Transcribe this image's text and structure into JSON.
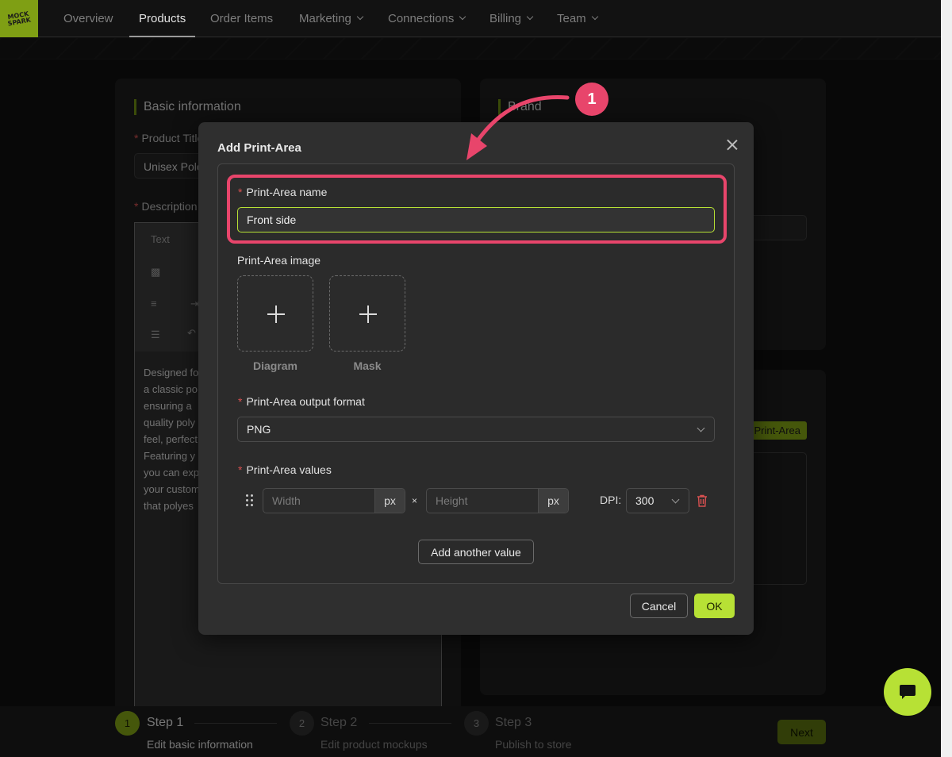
{
  "nav": {
    "logo_text": "MOCK\nSPARK",
    "items": [
      {
        "label": "Overview"
      },
      {
        "label": "Products"
      },
      {
        "label": "Order Items"
      },
      {
        "label": "Marketing"
      },
      {
        "label": "Connections"
      },
      {
        "label": "Billing"
      },
      {
        "label": "Team"
      }
    ]
  },
  "background": {
    "left_panel_title": "Basic information",
    "product_title_label": "Product Title",
    "product_title_value": "Unisex Polo",
    "description_label": "Description",
    "toolbar_text": "Text",
    "description_lines": [
      "Designed fo",
      "a classic po",
      "ensuring a",
      "quality poly",
      "feel, perfect",
      "Featuring y",
      "you can exp",
      "your custom",
      "that polyes"
    ],
    "right_panel_title": "Brand",
    "print_area_tag": "Print-Area"
  },
  "modal": {
    "title": "Add Print-Area",
    "name_label": "Print-Area name",
    "name_value": "Front side",
    "image_label": "Print-Area image",
    "upload_diagram": "Diagram",
    "upload_mask": "Mask",
    "format_label": "Print-Area output format",
    "format_value": "PNG",
    "values_label": "Print-Area values",
    "width_placeholder": "Width",
    "height_placeholder": "Height",
    "unit": "px",
    "times": "×",
    "dpi_label": "DPI:",
    "dpi_value": "300",
    "add_value_label": "Add another value",
    "cancel_label": "Cancel",
    "ok_label": "OK"
  },
  "annotation": {
    "badge": "1",
    "color": "#e8456b"
  },
  "steps": [
    {
      "num": "1",
      "title": "Step 1",
      "subtitle": "Edit basic information"
    },
    {
      "num": "2",
      "title": "Step 2",
      "subtitle": "Edit product mockups"
    },
    {
      "num": "3",
      "title": "Step 3",
      "subtitle": "Publish to store"
    }
  ],
  "next_label": "Next",
  "colors": {
    "accent": "#b7e135",
    "highlight": "#e8456b",
    "background": "#0f0f0f"
  }
}
